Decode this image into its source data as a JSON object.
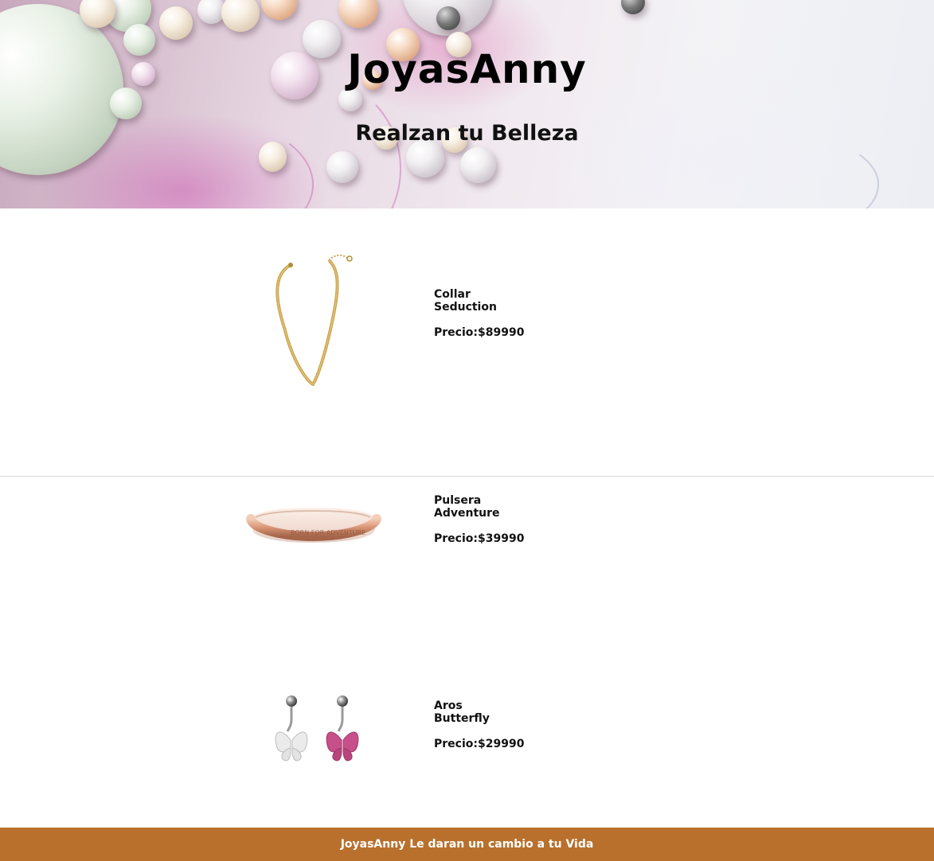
{
  "header": {
    "title": "JoyasAnny",
    "subtitle": "Realzan tu Belleza"
  },
  "products": [
    {
      "name_line1": "Collar",
      "name_line2": "Seduction",
      "price_label": "Precio:",
      "price": "$89990",
      "image_icon": "gold-necklace-image"
    },
    {
      "name_line1": "Pulsera",
      "name_line2": "Adventure",
      "price_label": "Precio:",
      "price": "$39990",
      "image_icon": "rose-gold-cuff-bracelet-image"
    },
    {
      "name_line1": "Aros",
      "name_line2": "Butterfly",
      "price_label": "Precio:",
      "price": "$29990",
      "image_icon": "butterfly-earrings-image"
    }
  ],
  "footer": {
    "text": "JoyasAnny Le daran un cambio a tu Vida"
  },
  "colors": {
    "footer_bg": "#b8702c",
    "footer_text": "#ffffff",
    "text": "#111111"
  }
}
